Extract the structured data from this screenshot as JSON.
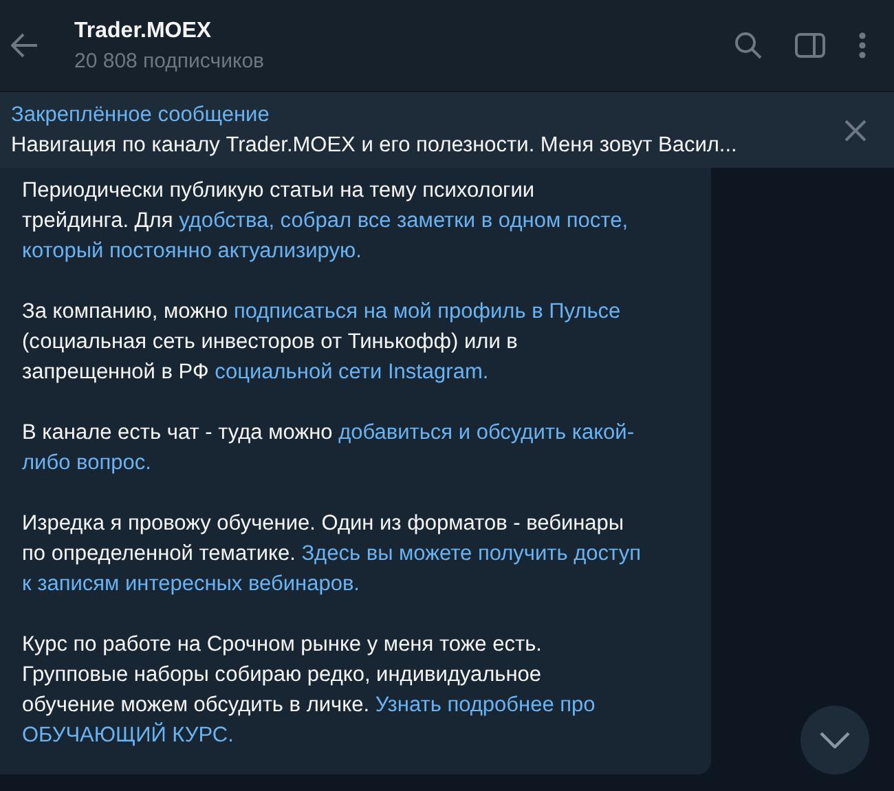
{
  "header": {
    "title": "Trader.MOEX",
    "subtitle": "20 808 подписчиков"
  },
  "pinned": {
    "label": "Закреплённое сообщение",
    "text": "Навигация по каналу Trader.MOEX и его полезности.  Меня зовут Васил..."
  },
  "message": {
    "paragraphs": [
      {
        "lines": [
          [
            {
              "text": "Периодически публикую статьи на тему психологии",
              "link": false
            }
          ],
          [
            {
              "text": "трейдинга. Для ",
              "link": false
            },
            {
              "text": "удобства, собрал все заметки в одном посте,",
              "link": true
            }
          ],
          [
            {
              "text": "который постоянно актуализирую.",
              "link": true
            }
          ]
        ]
      },
      {
        "lines": [
          [
            {
              "text": "За компанию, можно ",
              "link": false
            },
            {
              "text": "подписаться на мой профиль в Пульсе",
              "link": true
            }
          ],
          [
            {
              "text": "(социальная сеть инвесторов от Тинькофф) или в",
              "link": false
            }
          ],
          [
            {
              "text": "запрещенной в РФ ",
              "link": false
            },
            {
              "text": "социальной сети Instagram.",
              "link": true
            }
          ]
        ]
      },
      {
        "lines": [
          [
            {
              "text": "В канале есть чат - туда можно ",
              "link": false
            },
            {
              "text": "добавиться и обсудить какой-",
              "link": true
            }
          ],
          [
            {
              "text": "либо вопрос.",
              "link": true
            }
          ]
        ]
      },
      {
        "lines": [
          [
            {
              "text": "Изредка я провожу обучение. Один из форматов - вебинары",
              "link": false
            }
          ],
          [
            {
              "text": "по определенной тематике. ",
              "link": false
            },
            {
              "text": "Здесь вы можете получить доступ",
              "link": true
            }
          ],
          [
            {
              "text": "к записям интересных вебинаров.",
              "link": true
            }
          ]
        ]
      },
      {
        "lines": [
          [
            {
              "text": "Курс по работе на Срочном рынке у меня тоже есть.",
              "link": false
            }
          ],
          [
            {
              "text": "Групповые наборы собираю редко, индивидуальное",
              "link": false
            }
          ],
          [
            {
              "text": "обучение можем обсудить в личке. ",
              "link": false
            },
            {
              "text": "Узнать подробнее про",
              "link": true
            }
          ],
          [
            {
              "text": "ОБУЧАЮЩИЙ КУРС.",
              "link": true
            }
          ]
        ]
      }
    ]
  }
}
